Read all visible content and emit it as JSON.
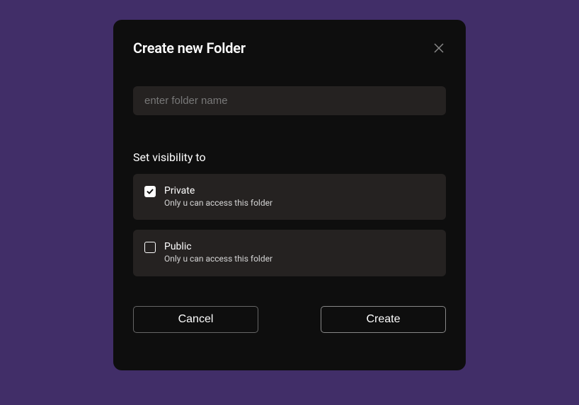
{
  "modal": {
    "title": "Create new Folder",
    "input": {
      "placeholder": "enter folder name",
      "value": ""
    },
    "visibility": {
      "label": "Set visibility to",
      "options": [
        {
          "title": "Private",
          "description": "Only u can access this folder",
          "checked": true
        },
        {
          "title": "Public",
          "description": "Only u can access this folder",
          "checked": false
        }
      ]
    },
    "buttons": {
      "cancel": "Cancel",
      "create": "Create"
    }
  }
}
